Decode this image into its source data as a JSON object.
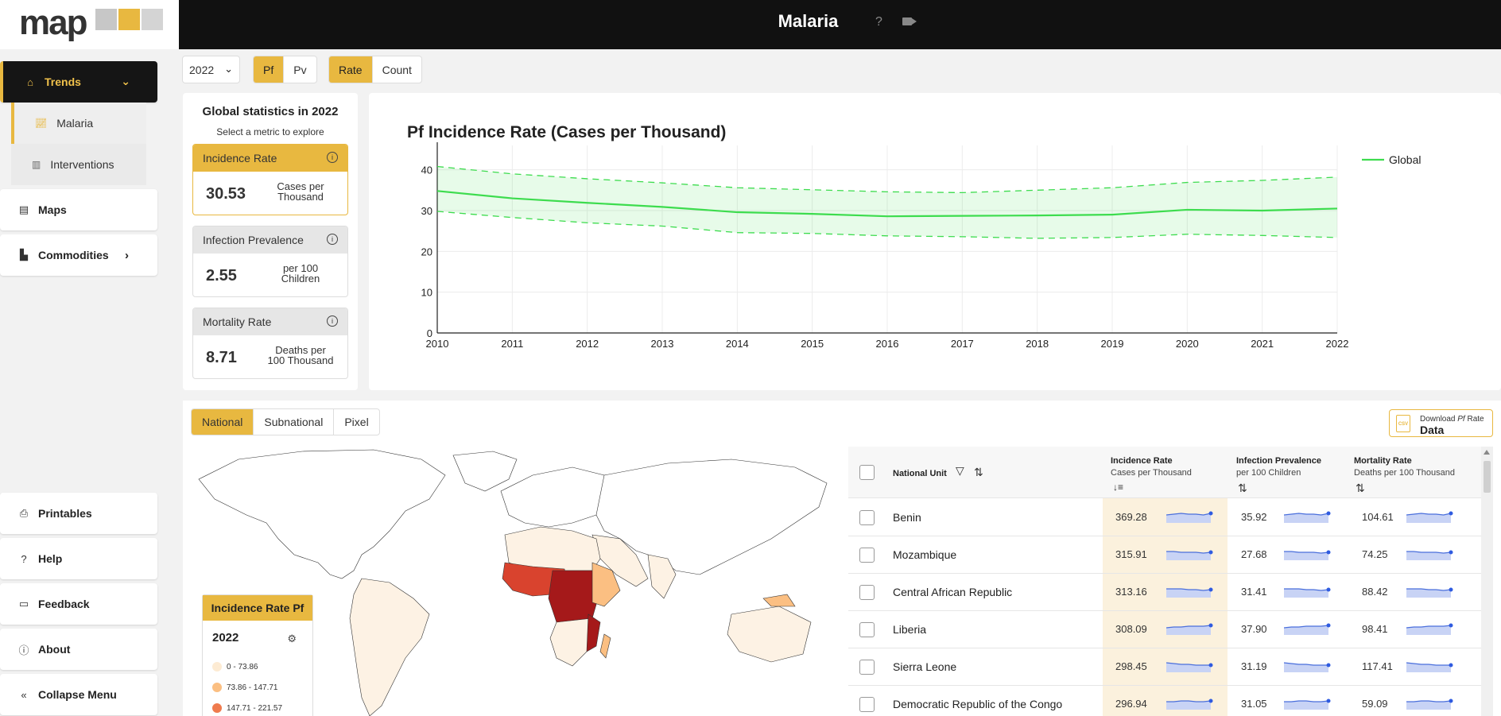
{
  "header": {
    "title": "Malaria",
    "help": "?"
  },
  "logo": {
    "text": "map"
  },
  "sidebar": {
    "trends": "Trends",
    "sub_items": [
      "Malaria",
      "Interventions"
    ],
    "maps": "Maps",
    "commodities": "Commodities",
    "bottom_items": [
      "Printables",
      "Help",
      "Feedback",
      "About",
      "Collapse Menu"
    ]
  },
  "controls": {
    "year": "2022",
    "parasite": [
      "Pf",
      "Pv"
    ],
    "measure": [
      "Rate",
      "Count"
    ]
  },
  "stats": {
    "title": "Global statistics in 2022",
    "subtitle": "Select a metric to explore",
    "metrics": [
      {
        "label": "Incidence Rate",
        "value": "30.53",
        "unit1": "Cases per",
        "unit2": "Thousand"
      },
      {
        "label": "Infection Prevalence",
        "value": "2.55",
        "unit1": "per 100",
        "unit2": "Children"
      },
      {
        "label": "Mortality Rate",
        "value": "8.71",
        "unit1": "Deaths per",
        "unit2": "100 Thousand"
      }
    ]
  },
  "chart_data": {
    "type": "line",
    "title": "Pf Incidence Rate (Cases per Thousand)",
    "x": [
      2010,
      2011,
      2012,
      2013,
      2014,
      2015,
      2016,
      2017,
      2018,
      2019,
      2020,
      2021,
      2022
    ],
    "series": [
      {
        "name": "Global",
        "values": [
          34.8,
          33.0,
          31.9,
          30.9,
          29.6,
          29.2,
          28.6,
          28.7,
          28.8,
          29.0,
          30.2,
          30.0,
          30.5
        ],
        "lower": [
          29.8,
          28.3,
          27.0,
          26.2,
          24.6,
          24.4,
          23.8,
          23.6,
          23.2,
          23.4,
          24.2,
          23.9,
          23.4
        ],
        "upper": [
          40.8,
          39.0,
          37.8,
          36.8,
          35.6,
          35.1,
          34.6,
          34.4,
          35.0,
          35.6,
          36.9,
          37.4,
          38.2
        ],
        "color": "#3ddc4e"
      }
    ],
    "ylim": [
      0,
      40
    ],
    "yticks": [
      0,
      10,
      20,
      30,
      40
    ],
    "legend": "top-right",
    "grid": true
  },
  "map_panel": {
    "levels": [
      "National",
      "Subnational",
      "Pixel"
    ],
    "download_l1": "Download",
    "download_l1b": "Pf",
    "download_l1c": "Rate",
    "download_l2": "Data",
    "csv": "CSV",
    "legend_title": "Incidence Rate Pf",
    "legend_year": "2022",
    "legend_bins": [
      {
        "label": "0 - 73.86",
        "color": "#fdebd3"
      },
      {
        "label": "73.86 - 147.71",
        "color": "#fbbf82"
      },
      {
        "label": "147.71 - 221.57",
        "color": "#ef7b4d"
      }
    ]
  },
  "table": {
    "col_name": "National Unit",
    "col_inc": "Incidence Rate",
    "col_inc_sub": "Cases per Thousand",
    "col_prev": "Infection Prevalence",
    "col_prev_sub": "per 100 Children",
    "col_mort": "Mortality Rate",
    "col_mort_sub": "Deaths per 100 Thousand",
    "rows": [
      {
        "name": "Benin",
        "inc": "369.28",
        "prev": "35.92",
        "mort": "104.61"
      },
      {
        "name": "Mozambique",
        "inc": "315.91",
        "prev": "27.68",
        "mort": "74.25"
      },
      {
        "name": "Central African Republic",
        "inc": "313.16",
        "prev": "31.41",
        "mort": "88.42"
      },
      {
        "name": "Liberia",
        "inc": "308.09",
        "prev": "37.90",
        "mort": "98.41"
      },
      {
        "name": "Sierra Leone",
        "inc": "298.45",
        "prev": "31.19",
        "mort": "117.41"
      },
      {
        "name": "Democratic Republic of the Congo",
        "inc": "296.94",
        "prev": "31.05",
        "mort": "59.09"
      }
    ]
  }
}
